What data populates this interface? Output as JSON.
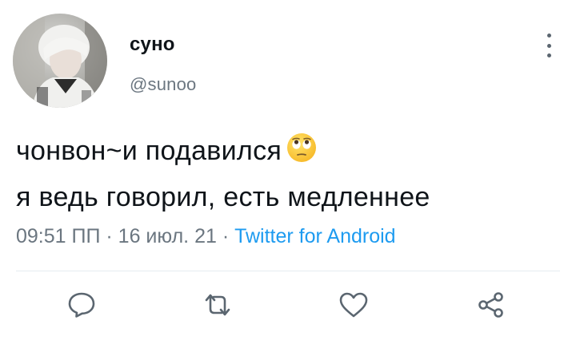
{
  "tweet": {
    "author": {
      "display_name": "суно",
      "handle": "@sunoo"
    },
    "text_lines": [
      "чонвон~и подавился",
      "я ведь говорил, есть медленнее"
    ],
    "emoji": "face-with-rolling-eyes",
    "meta": {
      "time": "09:51 ПП",
      "separator": " · ",
      "date": "16 июл. 21",
      "source": "Twitter for Android"
    }
  },
  "colors": {
    "text": "#0f1419",
    "secondary": "#6b7680",
    "link": "#1d9bf0",
    "divider": "#e6ecf0"
  },
  "icons": {
    "more": "more-vertical-icon",
    "reply": "reply-icon",
    "retweet": "retweet-icon",
    "like": "heart-icon",
    "share": "share-icon"
  }
}
